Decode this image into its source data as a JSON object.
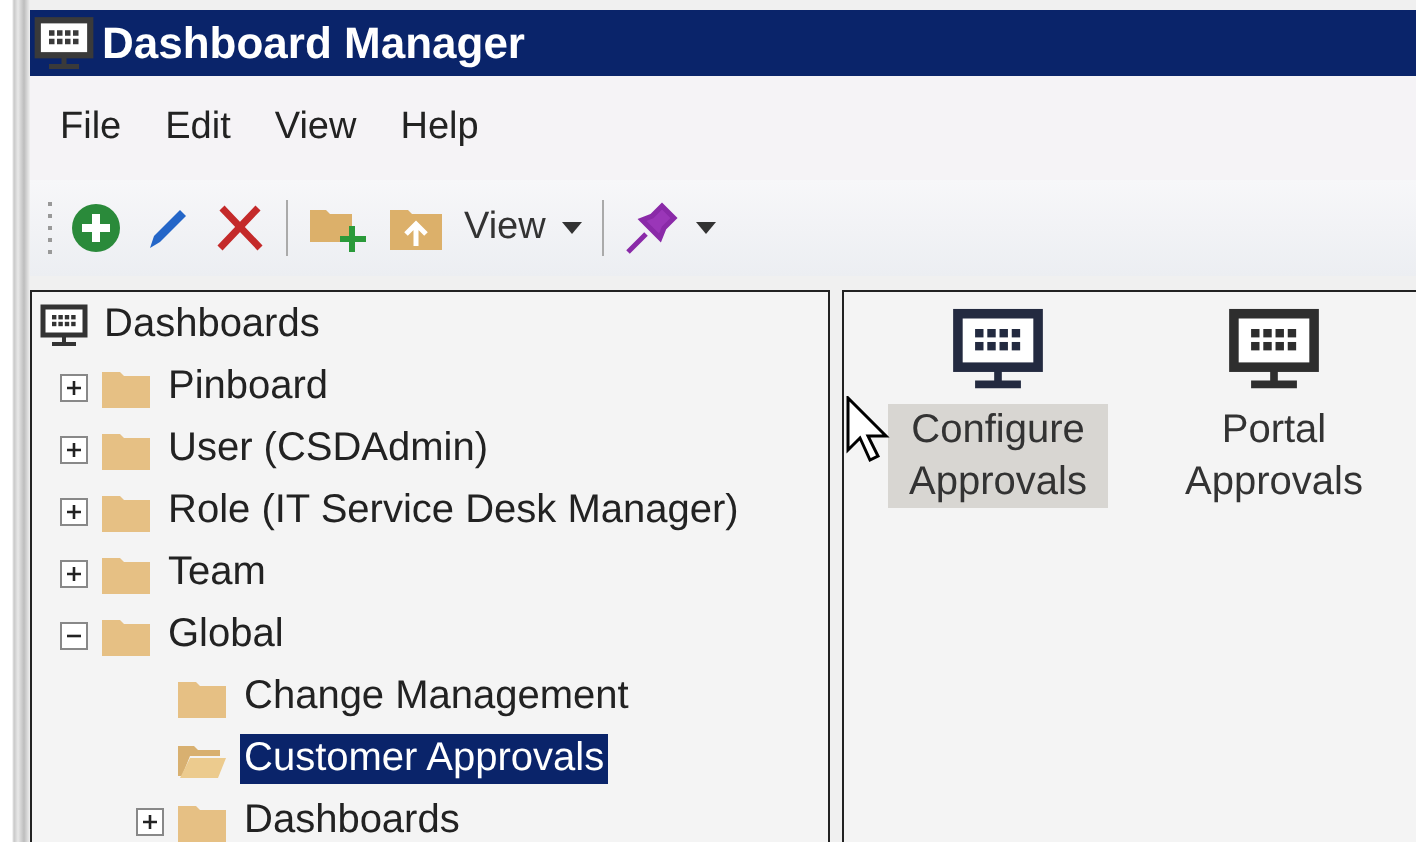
{
  "window": {
    "title": "Dashboard Manager"
  },
  "menu": [
    {
      "label": "File"
    },
    {
      "label": "Edit"
    },
    {
      "label": "View"
    },
    {
      "label": "Help"
    }
  ],
  "toolbar": [
    {
      "kind": "add"
    },
    {
      "kind": "edit"
    },
    {
      "kind": "delete"
    },
    {
      "kind": "separator"
    },
    {
      "kind": "new-folder"
    },
    {
      "kind": "upload-folder"
    },
    {
      "kind": "dropdown",
      "label": "View"
    },
    {
      "kind": "separator"
    },
    {
      "kind": "pin"
    }
  ],
  "tree": [
    {
      "label": "Dashboards",
      "selected": false,
      "children": [
        {
          "label": "Pinboard",
          "selected": false,
          "expanded": false
        },
        {
          "label": "User (CSDAdmin)",
          "selected": false,
          "expanded": false
        },
        {
          "label": "Role (IT Service Desk Manager)",
          "selected": false,
          "expanded": false
        },
        {
          "label": "Team",
          "selected": false,
          "expanded": false
        },
        {
          "label": "Global",
          "selected": false,
          "expanded": true,
          "children": [
            {
              "label": "Change Management",
              "selected": false
            },
            {
              "label": "Customer Approvals",
              "selected": true
            },
            {
              "label": "Dashboards",
              "selected": false,
              "expanded": false
            }
          ]
        }
      ]
    }
  ],
  "items": [
    {
      "label": "Configure Approvals",
      "selected": true
    },
    {
      "label": "Portal Approvals",
      "selected": false
    }
  ]
}
